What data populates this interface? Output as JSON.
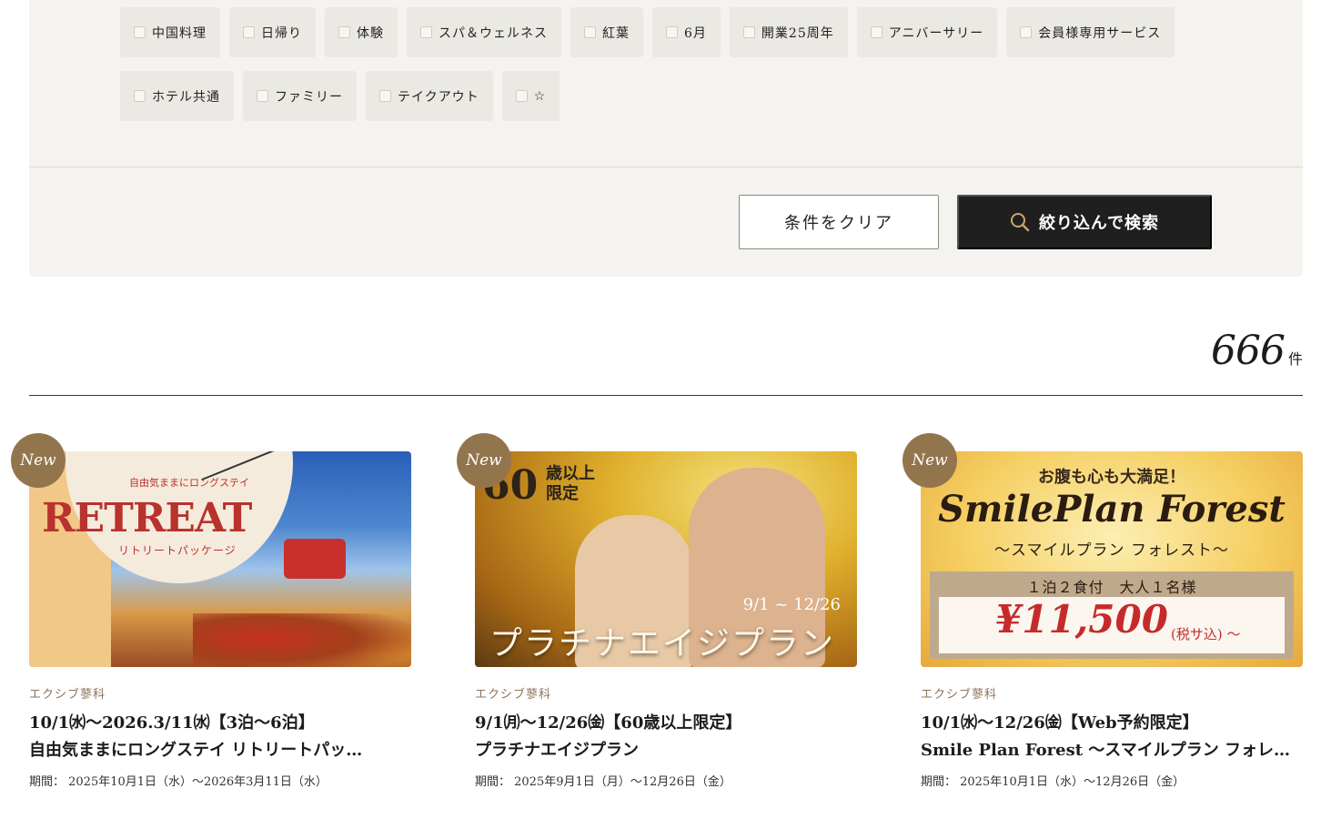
{
  "filters": {
    "row1": [
      "中国料理",
      "日帰り",
      "体験",
      "スパ＆ウェルネス",
      "紅葉",
      "6月",
      "開業25周年",
      "アニバーサリー",
      "会員様専用サービス"
    ],
    "row2": [
      "ホテル共通",
      "ファミリー",
      "テイクアウト",
      "☆"
    ],
    "clear_label": "条件をクリア",
    "search_label": "絞り込んで検索"
  },
  "results": {
    "count": "666",
    "unit": "件"
  },
  "cards": [
    {
      "badge": "New",
      "hotel": "エクシブ蓼科",
      "title_line1": "10/1㈬～2026.3/11㈬【3泊～6泊】",
      "title_line2": "自由気ままにロングステイ リトリートパッ…",
      "period": "期間： 2025年10月1日（水）～2026年3月11日（水）",
      "image": {
        "kicker": "自由気ままにロングステイ",
        "word": "RETREAT",
        "sub": "リトリートパッケージ"
      }
    },
    {
      "badge": "New",
      "hotel": "エクシブ蓼科",
      "title_line1": "9/1㈪～12/26㈮【60歳以上限定】",
      "title_line2": "プラチナエイジプラン",
      "period": "期間： 2025年9月1日（月）～12月26日（金）",
      "image": {
        "age": "60",
        "age_note": "歳以上限定",
        "date": "9/1 ~ 12/26",
        "name": "プラチナエイジプラン"
      }
    },
    {
      "badge": "New",
      "hotel": "エクシブ蓼科",
      "title_line1": "10/1㈬～12/26㈮【Web予約限定】",
      "title_line2": "Smile Plan Forest ～スマイルプラン フォレ…",
      "period": "期間： 2025年10月1日（水）～12月26日（金）",
      "image": {
        "kicker": "お腹も心も大満足！",
        "headline": "SmilePlan Forest",
        "sub": "～スマイルプラン フォレスト～",
        "box_line": "１泊２食付　大人１名様",
        "price": "¥11,500",
        "tax": "(税サ込) ～"
      }
    }
  ],
  "colors": {
    "panel_bg": "#f4f3ef",
    "tag_bg": "#ebe9e4",
    "badge": "#93754d",
    "hotel_text": "#8d7358",
    "search_btn": "#1f1f1f",
    "search_icon": "#c9a86a"
  },
  "icons": {
    "search": "search-icon",
    "checkbox": "checkbox-icon"
  }
}
